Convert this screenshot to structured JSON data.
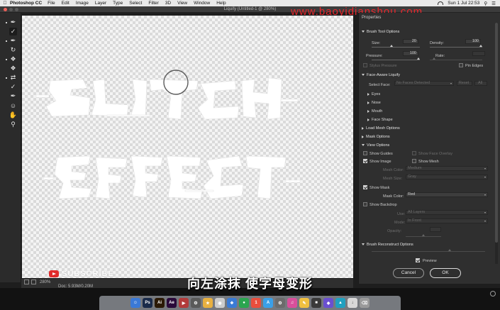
{
  "menubar": {
    "app_name": "Photoshop CC",
    "items": [
      "File",
      "Edit",
      "Image",
      "Layer",
      "Type",
      "Select",
      "Filter",
      "3D",
      "View",
      "Window",
      "Help"
    ],
    "clock": "Sun 1 Jul 22:53"
  },
  "window": {
    "title": "Liquify (Untitled-1 @ 280%)"
  },
  "watermark": "www.baoyidianshou.com",
  "canvas": {
    "subscribe_text": "SUBSCRIBE",
    "zoom": "280%",
    "doc_info": "Doc: 5.93M/0.20M"
  },
  "properties": {
    "title": "Properties",
    "brush_tool_options": {
      "header": "Brush Tool Options",
      "size_label": "Size:",
      "size_value": "20",
      "density_label": "Density:",
      "density_value": "100",
      "pressure_label": "Pressure:",
      "pressure_value": "100",
      "rate_label": "Rate:",
      "rate_value": "",
      "stylus_label": "Stylus Pressure",
      "pin_edges_label": "Pin Edges"
    },
    "face_aware": {
      "header": "Face-Aware Liquify",
      "select_face_label": "Select Face:",
      "select_face_value": "No Faces Detected",
      "reset_label": "Reset",
      "all_label": "All",
      "items": [
        "Eyes",
        "Nose",
        "Mouth",
        "Face Shape"
      ]
    },
    "load_mesh_header": "Load Mesh Options",
    "mask_options_header": "Mask Options",
    "view_options": {
      "header": "View Options",
      "show_guides": "Show Guides",
      "show_face_overlay": "Show Face Overlay",
      "show_image": "Show Image",
      "show_mesh": "Show Mesh",
      "mesh_color_label": "Mesh Color:",
      "mesh_color_value": "Medium",
      "mesh_size_label": "Mesh Size:",
      "mesh_size_value": "Gray",
      "show_mask": "Show Mask",
      "mask_color_label": "Mask Color:",
      "mask_color_value": "Red",
      "show_backdrop": "Show Backdrop",
      "use_label": "Use:",
      "use_value": "All Layers",
      "mode_label": "Mode:",
      "mode_value": "In Front",
      "opacity_label": "Opacity:",
      "opacity_value": ""
    },
    "brush_reconstruct_header": "Brush Reconstruct Options",
    "preview_label": "Preview",
    "cancel_label": "Cancel",
    "ok_label": "OK"
  },
  "subtitle": "向左涂抹 使字母变形",
  "colors": {
    "panel_bg": "#2f2f2f",
    "canvas_text": "#ffffff",
    "brush_cursor": "#5b5b5b"
  },
  "tool_icons": [
    "forward-warp-icon",
    "reconstruct-icon",
    "smooth-icon",
    "twirl-icon",
    "pucker-icon",
    "bloat-icon",
    "push-left-icon",
    "freeze-mask-icon",
    "thaw-mask-icon",
    "face-tool-icon",
    "hand-icon",
    "zoom-icon"
  ]
}
